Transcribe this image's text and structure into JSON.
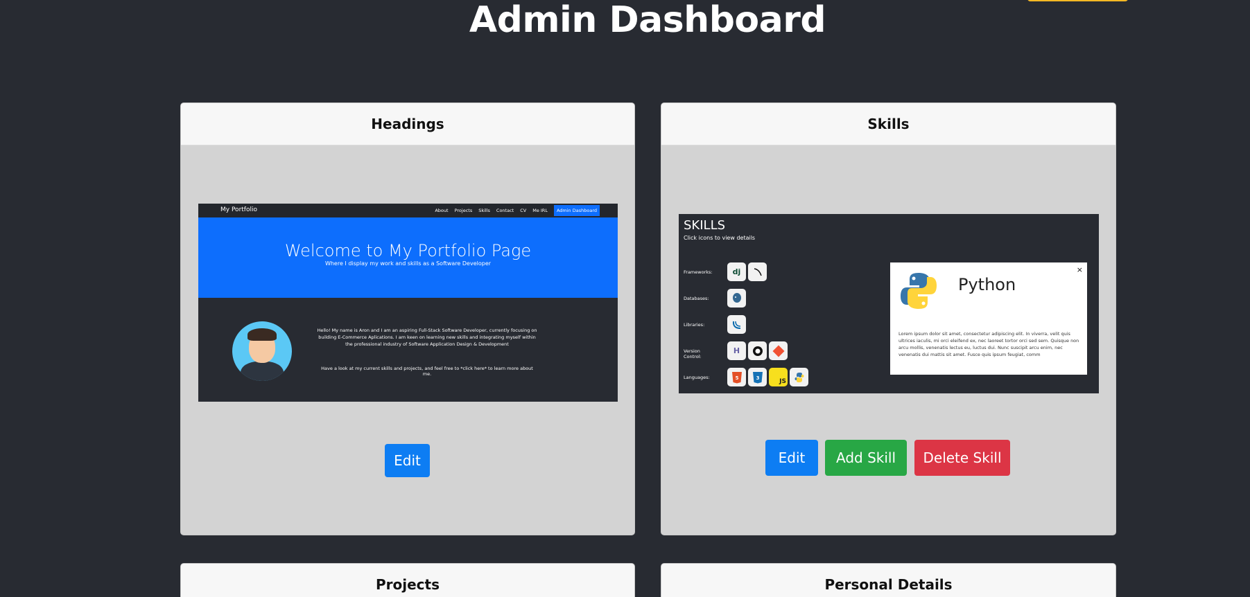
{
  "page": {
    "title": "Admin Dashboard"
  },
  "cards": {
    "headings": {
      "title": "Headings",
      "edit_label": "Edit",
      "preview": {
        "brand": "My Portfolio",
        "nav": [
          "About",
          "Projects",
          "Skills",
          "Contact",
          "CV",
          "Me IRL"
        ],
        "admin": "Admin Dashboard",
        "hero_title": "Welcome to My Portfolio Page",
        "hero_sub": "Where I display my work and skills as a Software Developer",
        "about": "Hello! My name is Aron and I am an aspiring Full-Stack Software Developer, currently focusing on building E-Commerce Aplications. I am keen on learning new skills and integrating myself within the professional industry of Software Application Design & Development",
        "look": "Have a look at my current skills and projects, and feel free to *click here* to learn more about me."
      }
    },
    "skills": {
      "title": "Skills",
      "edit_label": "Edit",
      "add_label": "Add Skill",
      "delete_label": "Delete Skill",
      "preview": {
        "title": "SKILLS",
        "sub": "Click icons to view details",
        "rows": [
          {
            "label": "Frameworks:",
            "icons": [
              "dj",
              "flask-icon"
            ]
          },
          {
            "label": "Databases:",
            "icons": [
              "postgres-icon"
            ]
          },
          {
            "label": "Libraries:",
            "icons": [
              "jquery-icon"
            ]
          },
          {
            "label": "Version Control:",
            "icons": [
              "heroku-icon",
              "github-icon",
              "git-icon"
            ]
          },
          {
            "label": "Languages:",
            "icons": [
              "html5-icon",
              "css3-icon",
              "JS",
              "python-icon"
            ]
          }
        ],
        "modal": {
          "close": "×",
          "name": "Python",
          "text": "Lorem ipsum dolor sit amet, consectetur adipiscing elit. In viverra, velit quis ultrices iaculis, mi orci eleifend ex, nec laoreet tortor orci sed sem. Quisque non arcu mollis, venenatis lectus eu, luctus dui. Nunc suscipit arcu enim, nec venenatis dui mattis sit amet. Fusce quis ipsum feugiat, comm"
        }
      }
    },
    "projects": {
      "title": "Projects"
    },
    "personal": {
      "title": "Personal Details"
    }
  }
}
